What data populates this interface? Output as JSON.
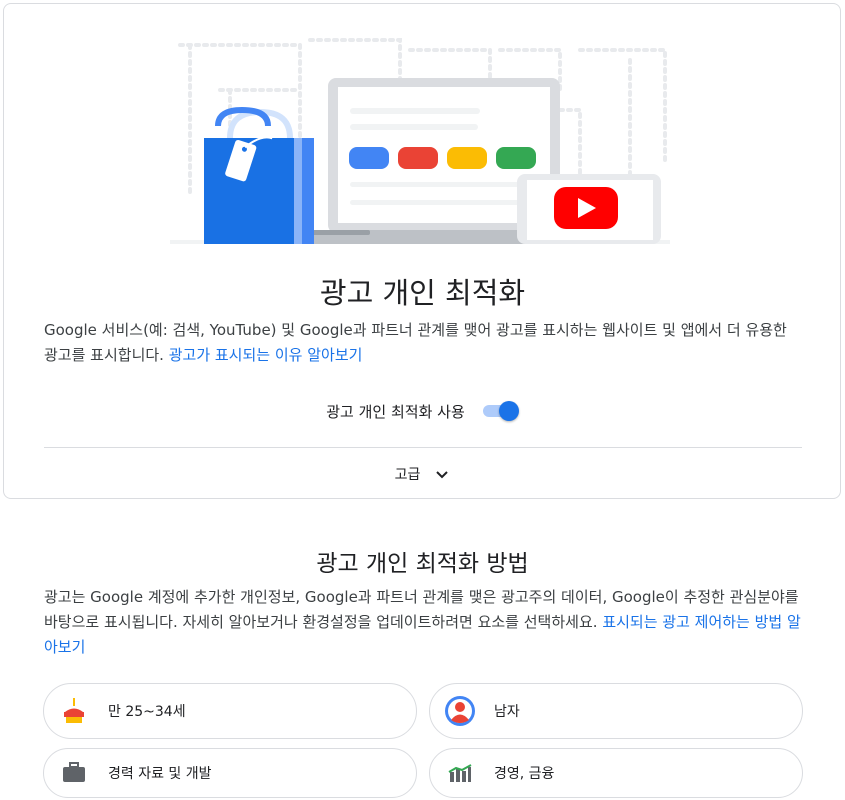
{
  "hero": {
    "title": "광고 개인 최적화",
    "description": "Google 서비스(예: 검색, YouTube) 및 Google과 파트너 관계를 맺어 광고를 표시하는 웹사이트 및 앱에서 더 유용한 광고를 표시합니다.",
    "learn_more_link": "광고가 표시되는 이유 알아보기",
    "toggle_label": "광고 개인 최적화 사용",
    "toggle_on": true,
    "advanced_label": "고급"
  },
  "how": {
    "title": "광고 개인 최적화 방법",
    "description": "광고는 Google 계정에 추가한 개인정보, Google과 파트너 관계를 맺은 광고주의 데이터, Google이 추정한 관심분야를 바탕으로 표시됩니다. 자세히 알아보거나 환경설정을 업데이트하려면 요소를 선택하세요.",
    "link": "표시되는 광고 제어하는 방법 알아보기"
  },
  "factors": [
    {
      "label": "만 25~34세",
      "icon": "birthday-cake-icon"
    },
    {
      "label": "남자",
      "icon": "person-icon"
    },
    {
      "label": "경력 자료 및 개발",
      "icon": "briefcase-icon"
    },
    {
      "label": "경영, 금융",
      "icon": "finance-chart-icon"
    }
  ],
  "colors": {
    "accent": "#1a73e8",
    "google_blue": "#4285f4",
    "google_red": "#ea4335",
    "google_yellow": "#fbbc04",
    "google_green": "#34a853",
    "youtube_red": "#ff0000"
  }
}
